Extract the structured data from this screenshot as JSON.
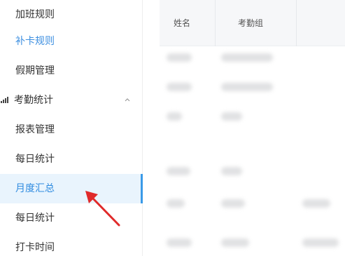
{
  "sidebar": {
    "items": [
      {
        "label": "加班规则",
        "state": "normal"
      },
      {
        "label": "补卡规则",
        "state": "link"
      },
      {
        "label": "假期管理",
        "state": "normal"
      },
      {
        "label": "考勤统计",
        "state": "group"
      },
      {
        "label": "报表管理",
        "state": "normal"
      },
      {
        "label": "每日统计",
        "state": "normal"
      },
      {
        "label": "月度汇总",
        "state": "active"
      },
      {
        "label": "每日统计",
        "state": "normal"
      },
      {
        "label": "打卡时间",
        "state": "normal"
      }
    ]
  },
  "table": {
    "columns": [
      "姓名",
      "考勤组",
      ""
    ]
  },
  "colors": {
    "accent": "#3a9ae8",
    "active_bg": "#e9f4fd",
    "annotation": "#e02a2a"
  }
}
